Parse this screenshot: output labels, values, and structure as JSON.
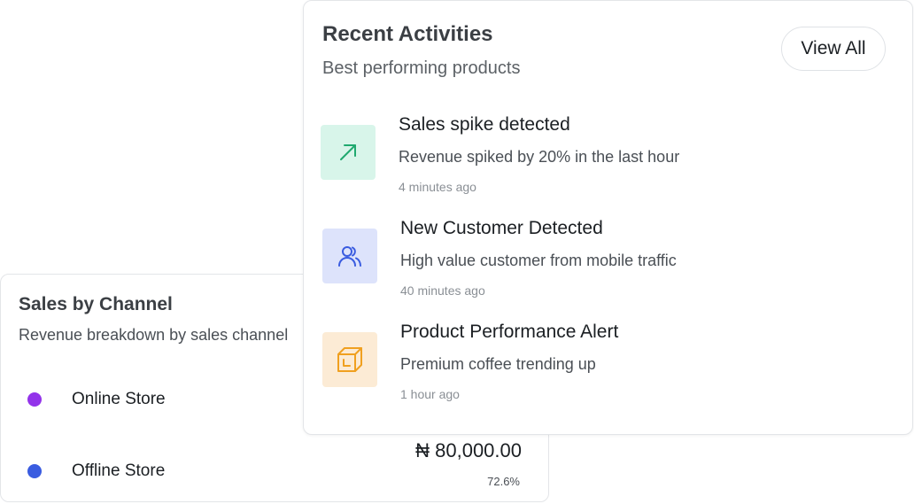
{
  "sales_by_channel": {
    "title": "Sales by Channel",
    "subtitle": "Revenue breakdown by sales channel",
    "channels": [
      {
        "name": "Online Store",
        "color": "#9333ea",
        "amount": "",
        "percent": ""
      },
      {
        "name": "Offline Store",
        "color": "#3a5ce0",
        "amount": "₦ 80,000.00",
        "percent": "72.6%"
      }
    ]
  },
  "recent_activities": {
    "title": "Recent Activities",
    "subtitle": "Best performing products",
    "view_all_label": "View All",
    "items": [
      {
        "icon": "trending-up-arrow-icon",
        "icon_bg": "#d8f5ea",
        "icon_color": "#1fa96f",
        "title": "Sales spike detected",
        "description": "Revenue spiked by 20% in the last hour",
        "time": "4 minutes ago"
      },
      {
        "icon": "users-icon",
        "icon_bg": "#dde3fb",
        "icon_color": "#3a5ce0",
        "title": "New Customer Detected",
        "description": "High value customer from mobile traffic",
        "time": "40 minutes ago"
      },
      {
        "icon": "box-icon",
        "icon_bg": "#fcebd5",
        "icon_color": "#f0a020",
        "title": "Product Performance Alert",
        "description": "Premium coffee trending up",
        "time": "1 hour ago"
      }
    ]
  }
}
